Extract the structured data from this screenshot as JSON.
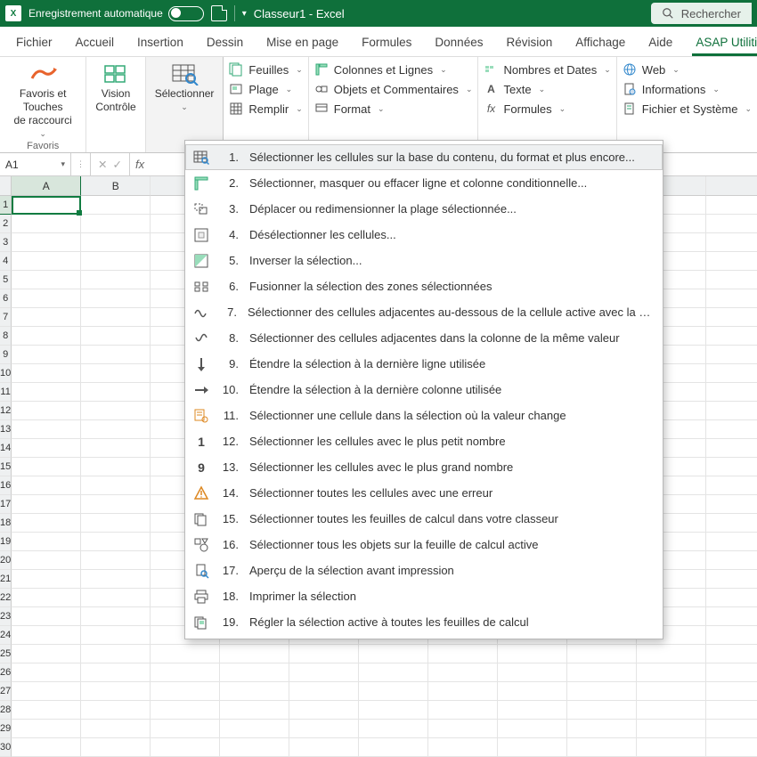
{
  "title": {
    "autosave_label": "Enregistrement automatique",
    "doc_title": "Classeur1  -  Excel",
    "search_label": "Rechercher"
  },
  "tabs": {
    "t0": "Fichier",
    "t1": "Accueil",
    "t2": "Insertion",
    "t3": "Dessin",
    "t4": "Mise en page",
    "t5": "Formules",
    "t6": "Données",
    "t7": "Révision",
    "t8": "Affichage",
    "t9": "Aide",
    "t10": "ASAP Utilities"
  },
  "ribbon": {
    "favorites": "Favoris et Touches\nde raccourci",
    "favorites_group": "Favoris",
    "vision": "Vision\nContrôle",
    "select": "Sélectionner",
    "col1": {
      "a": "Feuilles",
      "b": "Plage",
      "c": "Remplir"
    },
    "col2": {
      "a": "Colonnes et Lignes",
      "b": "Objets et Commentaires",
      "c": "Format"
    },
    "col3": {
      "a": "Nombres et Dates",
      "b": "Texte",
      "c": "Formules"
    },
    "col4": {
      "a": "Web",
      "b": "Informations",
      "c": "Fichier et Système"
    }
  },
  "namebox": {
    "ref": "A1"
  },
  "cols": [
    "A",
    "B",
    "",
    "",
    "",
    "",
    "",
    "",
    "J"
  ],
  "rows": [
    "1",
    "2",
    "3",
    "4",
    "5",
    "6",
    "7",
    "8",
    "9",
    "10",
    "11",
    "12",
    "13",
    "14",
    "15",
    "16",
    "17",
    "18",
    "19",
    "20",
    "21",
    "22",
    "23",
    "24",
    "25",
    "26",
    "27",
    "28",
    "29",
    "30"
  ],
  "menu": {
    "m1": "Sélectionner les cellules sur la base du contenu, du format et plus encore...",
    "m2": "Sélectionner, masquer ou effacer ligne et colonne conditionnelle...",
    "m3": "Déplacer ou redimensionner la plage sélectionnée...",
    "m4": "Désélectionner les cellules...",
    "m5": "Inverser la sélection...",
    "m6": "Fusionner la sélection des zones sélectionnées",
    "m7": "Sélectionner des cellules adjacentes au-dessous de la cellule active avec la même valeur",
    "m8": "Sélectionner des cellules adjacentes dans la colonne de la même valeur",
    "m9": "Étendre la sélection à la dernière ligne utilisée",
    "m10": "Étendre la sélection à la dernière colonne utilisée",
    "m11": "Sélectionner une cellule dans la sélection où la valeur change",
    "m12": "Sélectionner les cellules avec le plus petit nombre",
    "m13": "Sélectionner les cellules avec le plus grand nombre",
    "m14": "Sélectionner toutes les cellules avec une erreur",
    "m15": "Sélectionner toutes les feuilles de calcul dans votre classeur",
    "m16": "Sélectionner tous les objets sur la feuille de calcul active",
    "m17": "Aperçu de la sélection avant impression",
    "m18": "Imprimer la sélection",
    "m19": "Régler la sélection active à toutes les feuilles de calcul"
  },
  "menu_num": {
    "m1": "1.",
    "m2": "2.",
    "m3": "3.",
    "m4": "4.",
    "m5": "5.",
    "m6": "6.",
    "m7": "7.",
    "m8": "8.",
    "m9": "9.",
    "m10": "10.",
    "m11": "11.",
    "m12": "12.",
    "m13": "13.",
    "m14": "14.",
    "m15": "15.",
    "m16": "16.",
    "m17": "17.",
    "m18": "18.",
    "m19": "19."
  }
}
